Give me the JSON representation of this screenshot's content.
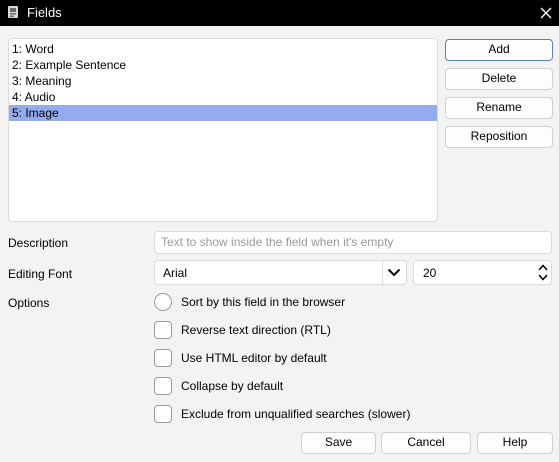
{
  "window": {
    "title": "Fields",
    "title_icon": "anki-app-icon",
    "close_icon": "close-icon"
  },
  "fields": [
    {
      "label": "1: Word",
      "selected": false
    },
    {
      "label": "2: Example Sentence",
      "selected": false
    },
    {
      "label": "3: Meaning",
      "selected": false
    },
    {
      "label": "4: Audio",
      "selected": false
    },
    {
      "label": "5: Image",
      "selected": true
    }
  ],
  "side_buttons": {
    "add": "Add",
    "delete": "Delete",
    "rename": "Rename",
    "reposition": "Reposition"
  },
  "description": {
    "label": "Description",
    "placeholder": "Text to show inside the field when it's empty",
    "value": ""
  },
  "editing_font": {
    "label": "Editing Font",
    "font": "Arial",
    "size": "20"
  },
  "options": {
    "label": "Options",
    "items": [
      {
        "label": "Sort by this field in the browser",
        "checked": false
      },
      {
        "label": "Reverse text direction (RTL)",
        "checked": false
      },
      {
        "label": "Use HTML editor by default",
        "checked": false
      },
      {
        "label": "Collapse by default",
        "checked": false
      },
      {
        "label": "Exclude from unqualified searches (slower)",
        "checked": false
      }
    ]
  },
  "footer": {
    "save": "Save",
    "cancel": "Cancel",
    "help": "Help"
  },
  "colors": {
    "selection": "#94acef",
    "titlebar": "#000000",
    "background": "#f3f3f3"
  }
}
